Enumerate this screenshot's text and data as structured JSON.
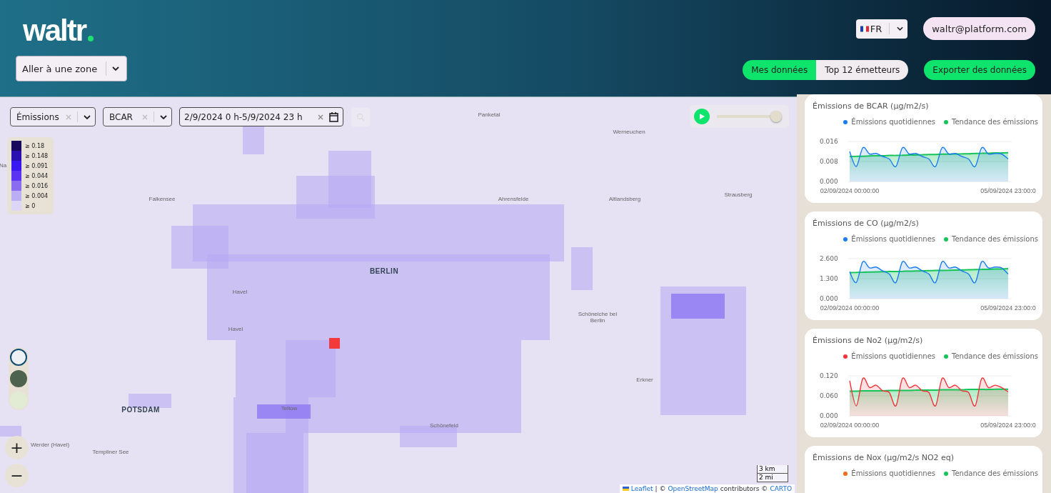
{
  "header": {
    "logo": "waltr",
    "zone_select": {
      "value": "Aller à une zone"
    },
    "language": {
      "value": "FR"
    },
    "user_email": "waltr@platform.com",
    "view_tabs": [
      {
        "label": "Mes données",
        "selected": true
      },
      {
        "label": "Top 12 émetteurs",
        "selected": false
      }
    ],
    "export_button": "Exporter des données"
  },
  "map": {
    "filters": [
      {
        "value": "Émissions"
      },
      {
        "value": "BCAR"
      }
    ],
    "date_range": "2/9/2024 0 h-5/9/2024 23 h",
    "timeline": {
      "level": 1
    },
    "legend": [
      {
        "label": "≥ 0.18",
        "color": "#1a0a5e"
      },
      {
        "label": "≥ 0.148",
        "color": "#2a10b0"
      },
      {
        "label": "≥ 0.091",
        "color": "#3a16f0"
      },
      {
        "label": "≥ 0.044",
        "color": "#5a34f2"
      },
      {
        "label": "≥ 0.016",
        "color": "#8a6cf0"
      },
      {
        "label": "≥ 0.004",
        "color": "#bcaef4"
      },
      {
        "label": "≥ 0",
        "color": "#ddd6f6"
      }
    ],
    "places": [
      "Panketal",
      "Werneuchen",
      "Ahrensfelde",
      "Strausberg",
      "Falkensee",
      "Altlandsberg",
      "BERLIN",
      "Havel",
      "Havel",
      "Schöneiche bei Berlin",
      "Erkner",
      "POTSDAM",
      "Teltow",
      "Schönefeld",
      "Werder (Havel)",
      "Templiner See",
      "Na"
    ],
    "base_layers": [
      {
        "selected": true
      },
      {
        "selected": false
      },
      {
        "selected": false
      }
    ],
    "zoom": [
      "+",
      "−"
    ],
    "scale": [
      "3 km",
      "2 mi"
    ],
    "attribution": [
      {
        "kind": "link",
        "text": "Leaflet"
      },
      {
        "kind": "text",
        "text": "| ©"
      },
      {
        "kind": "link",
        "text": "OpenStreetMap"
      },
      {
        "kind": "text",
        "text": "contributors ©"
      },
      {
        "kind": "link",
        "text": "CARTO"
      }
    ]
  },
  "charts": [
    {
      "title": "Émissions de BCAR (µg/m2/s)",
      "chart_data": {
        "type": "area",
        "categories": [
          "02/09/2024 00:00:00",
          null,
          null,
          null,
          null,
          null,
          null,
          null,
          null,
          null,
          null,
          null,
          null,
          null,
          null,
          null,
          null,
          null,
          null,
          null,
          null,
          null,
          null,
          null,
          "05/09/2024 23:00:0"
        ],
        "ylim": [
          0,
          0.016
        ],
        "yticks": [
          {
            "value": 0,
            "label": "0.000"
          },
          {
            "value": 0.008,
            "label": "0.008"
          },
          {
            "value": 0.016,
            "label": "0.016"
          }
        ],
        "series": [
          {
            "name": "Émissions quotidiennes",
            "color": "#1a7cf0",
            "values": [
              0.012,
              0.006,
              0.0135,
              0.011,
              0.0112,
              0.01,
              0.009,
              0.006,
              0.0135,
              0.011,
              0.0112,
              0.01,
              0.009,
              0.006,
              0.0135,
              0.011,
              0.0112,
              0.01,
              0.009,
              0.006,
              0.0135,
              0.011,
              0.0112,
              0.011,
              0.009
            ]
          },
          {
            "name": "Tendance des émissions",
            "color": "#16c45a",
            "values": [
              0.01,
              0.0101,
              0.0101,
              0.0102,
              0.0103,
              0.0103,
              0.0104,
              0.0104,
              0.0105,
              0.0106,
              0.0106,
              0.0107,
              0.0108,
              0.0108,
              0.0109,
              0.0109,
              0.011,
              0.0111,
              0.0111,
              0.0112,
              0.0113,
              0.0113,
              0.0114,
              0.0114,
              0.0115
            ]
          }
        ]
      }
    },
    {
      "title": "Émissions de CO (µg/m2/s)",
      "chart_data": {
        "type": "area",
        "categories": [
          "02/09/2024 00:00:00",
          null,
          null,
          null,
          null,
          null,
          null,
          null,
          null,
          null,
          null,
          null,
          null,
          null,
          null,
          null,
          null,
          null,
          null,
          null,
          null,
          null,
          null,
          null,
          "05/09/2024 23:00:0"
        ],
        "ylim": [
          0,
          2.6
        ],
        "yticks": [
          {
            "value": 0,
            "label": "0.000"
          },
          {
            "value": 1.3,
            "label": "1.300"
          },
          {
            "value": 2.6,
            "label": "2.600"
          }
        ],
        "series": [
          {
            "name": "Émissions quotidiennes",
            "color": "#1a7cf0",
            "values": [
              1.75,
              1.05,
              2.4,
              2.0,
              2.05,
              1.8,
              1.6,
              1.05,
              2.4,
              2.0,
              2.05,
              1.8,
              1.6,
              1.05,
              2.4,
              2.0,
              2.05,
              1.8,
              1.6,
              1.05,
              2.4,
              2.0,
              2.05,
              2.0,
              1.6
            ]
          },
          {
            "name": "Tendance des émissions",
            "color": "#16c45a",
            "values": [
              1.7,
              1.71,
              1.72,
              1.73,
              1.74,
              1.75,
              1.76,
              1.77,
              1.78,
              1.79,
              1.8,
              1.81,
              1.82,
              1.83,
              1.84,
              1.85,
              1.86,
              1.87,
              1.88,
              1.89,
              1.9,
              1.91,
              1.92,
              1.93,
              1.95
            ]
          }
        ]
      }
    },
    {
      "title": "Émissions de No2 (µg/m2/s)",
      "chart_data": {
        "type": "area",
        "categories": [
          "02/09/2024 00:00:00",
          null,
          null,
          null,
          null,
          null,
          null,
          null,
          null,
          null,
          null,
          null,
          null,
          null,
          null,
          null,
          null,
          null,
          null,
          null,
          null,
          null,
          null,
          null,
          "05/09/2024 23:00:0"
        ],
        "ylim": [
          0,
          0.12
        ],
        "yticks": [
          {
            "value": 0,
            "label": "0.000"
          },
          {
            "value": 0.06,
            "label": "0.060"
          },
          {
            "value": 0.12,
            "label": "0.120"
          }
        ],
        "series": [
          {
            "name": "Émissions quotidiennes",
            "color": "#f0343c",
            "values": [
              0.105,
              0.03,
              0.112,
              0.085,
              0.092,
              0.075,
              0.07,
              0.03,
              0.112,
              0.085,
              0.092,
              0.075,
              0.07,
              0.03,
              0.112,
              0.085,
              0.092,
              0.075,
              0.07,
              0.03,
              0.112,
              0.085,
              0.092,
              0.085,
              0.072
            ]
          },
          {
            "name": "Tendance des émissions",
            "color": "#16c45a",
            "values": [
              0.074,
              0.074,
              0.075,
              0.075,
              0.075,
              0.075,
              0.076,
              0.076,
              0.076,
              0.076,
              0.077,
              0.077,
              0.077,
              0.077,
              0.078,
              0.078,
              0.078,
              0.078,
              0.079,
              0.079,
              0.079,
              0.079,
              0.08,
              0.08,
              0.08
            ]
          }
        ]
      }
    },
    {
      "title": "Émissions de Nox (µg/m2/s NO2 eq)",
      "legend": [
        {
          "name": "Émissions quotidiennes",
          "color": "#f26b1d"
        },
        {
          "name": "Tendance des émissions",
          "color": "#16c45a"
        }
      ]
    }
  ]
}
